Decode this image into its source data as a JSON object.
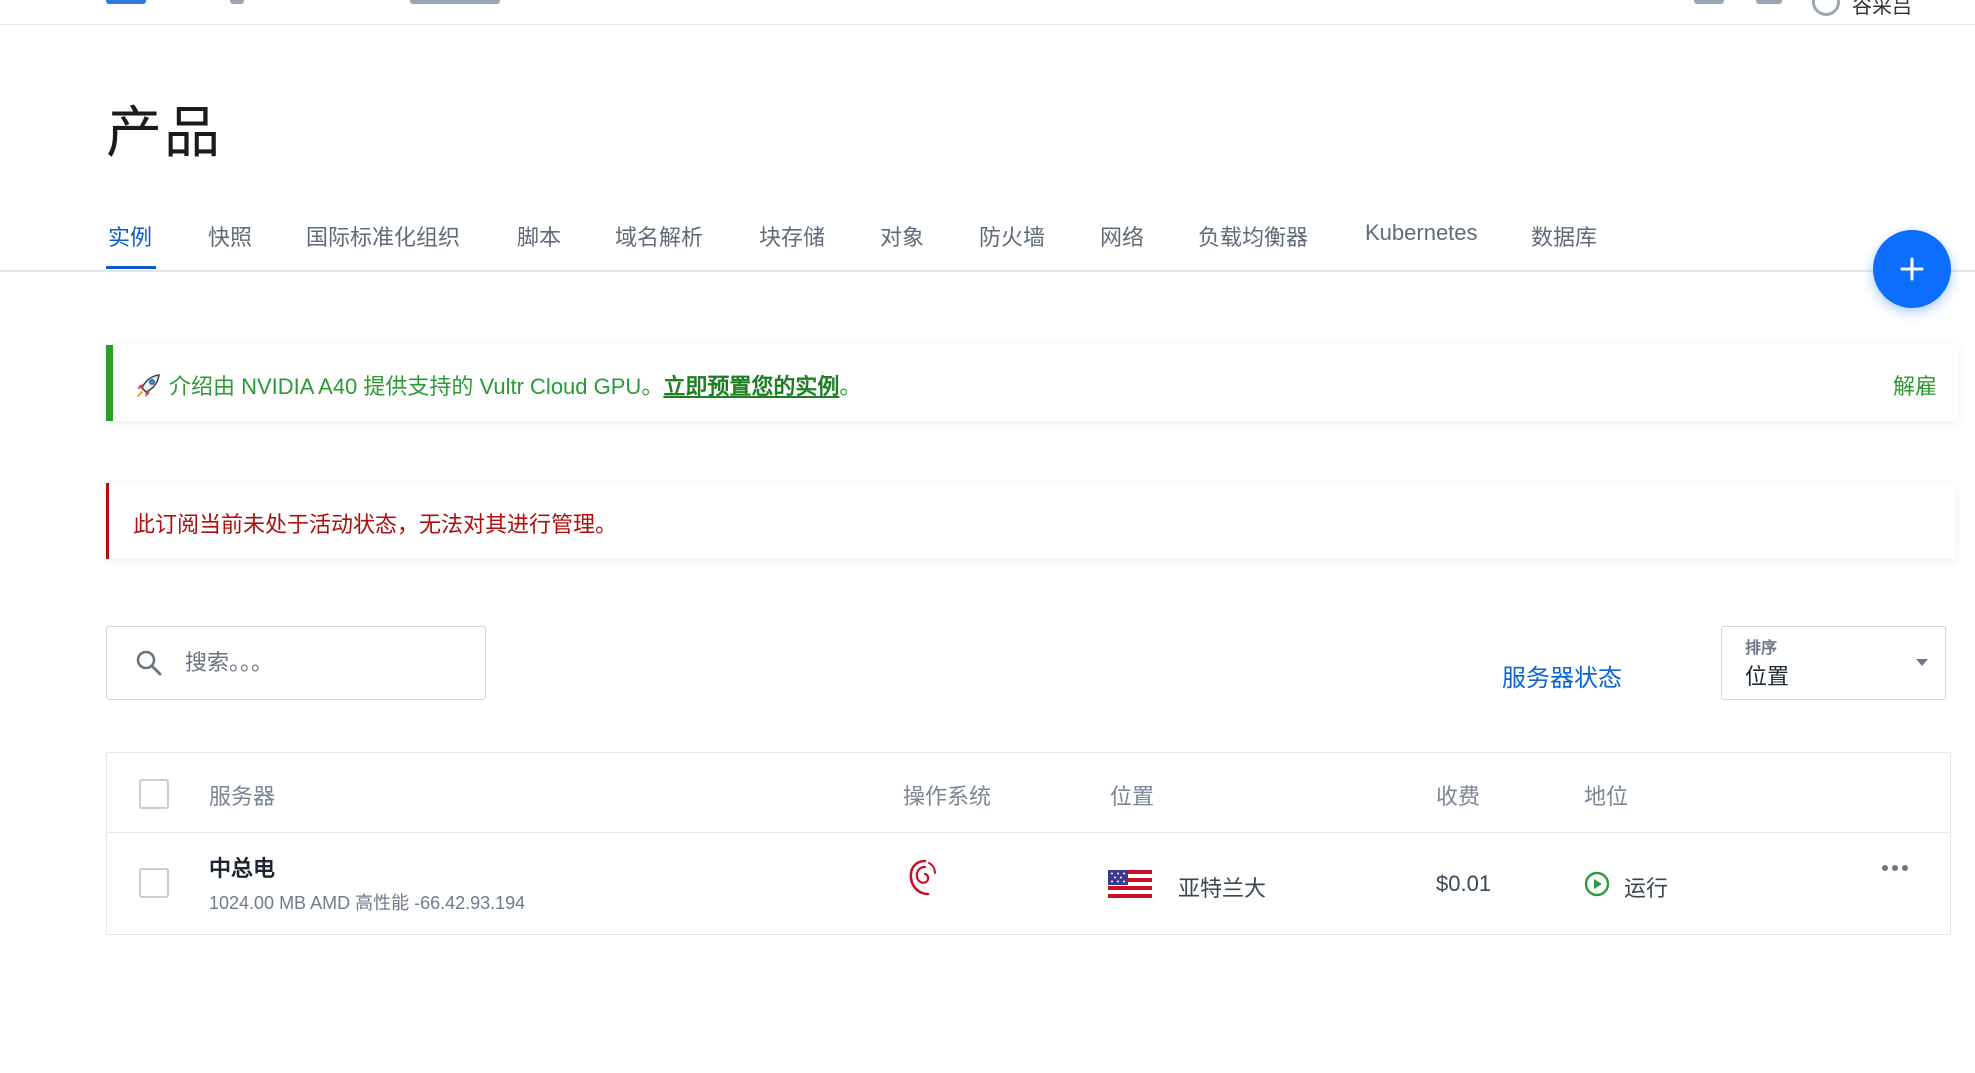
{
  "topbar": {
    "right_label": "谷采吕"
  },
  "page": {
    "title": "产品"
  },
  "tabs": [
    {
      "label": "实例",
      "active": true
    },
    {
      "label": "快照"
    },
    {
      "label": "国际标准化组织"
    },
    {
      "label": "脚本"
    },
    {
      "label": "域名解析"
    },
    {
      "label": "块存储"
    },
    {
      "label": "对象"
    },
    {
      "label": "防火墙"
    },
    {
      "label": "网络"
    },
    {
      "label": "负载均衡器"
    },
    {
      "label": "Kubernetes"
    },
    {
      "label": "数据库"
    }
  ],
  "fab": {
    "icon": "plus-icon"
  },
  "promo_banner": {
    "icon": "rocket-icon",
    "text": "介绍由 NVIDIA A40 提供支持的 Vultr Cloud GPU。",
    "link": "立即预置您的实例",
    "suffix": "。",
    "dismiss": "解雇",
    "color": "#27a02a"
  },
  "alert_banner": {
    "text": "此订阅当前未处于活动状态，无法对其进行管理。",
    "color": "#b00d0d"
  },
  "search": {
    "placeholder": "搜索。。。",
    "value": ""
  },
  "server_status_link": "服务器状态",
  "sort": {
    "label": "排序",
    "value": "位置"
  },
  "table": {
    "headers": {
      "server": "服务器",
      "os": "操作系统",
      "location": "位置",
      "charges": "收费",
      "status": "地位"
    },
    "rows": [
      {
        "name": "中总电",
        "description": "1024.00 MB AMD 高性能 -66.42.93.194",
        "os_icon": "debian-icon",
        "flag_icon": "us-flag-icon",
        "location": "亚特兰大",
        "charges": "$0.01",
        "status": "运行",
        "status_color": "#2e9b3b"
      }
    ]
  },
  "colors": {
    "accent": "#0a5ad0",
    "fab": "#0d6efd"
  }
}
